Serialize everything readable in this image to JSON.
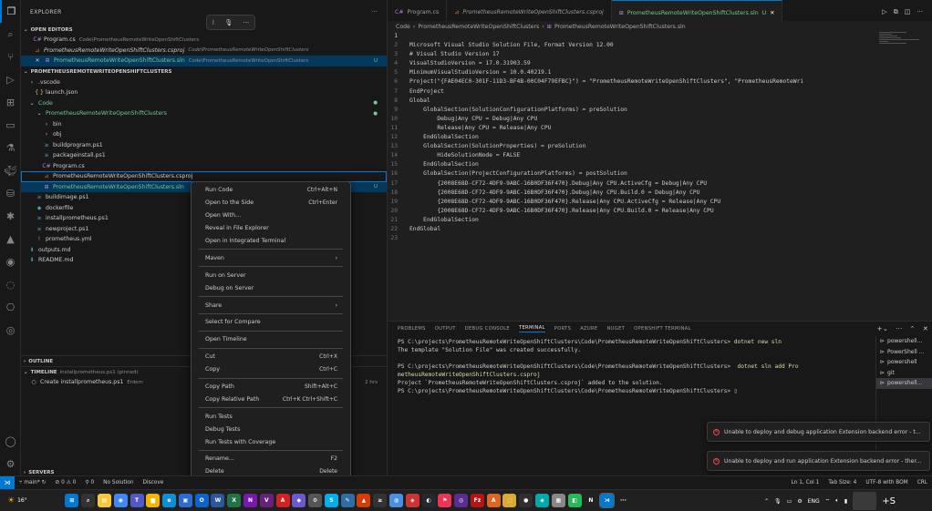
{
  "sidebar": {
    "title": "EXPLORER",
    "open_editors_label": "OPEN EDITORS",
    "open_editors": [
      {
        "name": "Program.cs",
        "path": "Code\\PrometheusRemoteWriteOpenShiftClusters",
        "icon": "csharp-icon"
      },
      {
        "name": "PrometheusRemoteWriteOpenShiftClusters.csproj",
        "path": "Code\\PrometheusRemoteWriteOpenShiftClusters",
        "icon": "rss-icon"
      },
      {
        "name": "PrometheusRemoteWriteOpenShiftClusters.sln",
        "path": "Code\\PrometheusRemoteWriteOpenShiftClusters",
        "badge": "U",
        "icon": "sln-icon"
      }
    ],
    "project_label": "PROMETHEUSREMOTEWRITEOPENSHIFTCLUSTERS",
    "tree": [
      {
        "label": ".vscode",
        "depth": 0,
        "twisty": "›",
        "type": "folder"
      },
      {
        "label": "launch.json",
        "depth": 1,
        "type": "json"
      },
      {
        "label": "Code",
        "depth": 0,
        "twisty": "⌄",
        "type": "folder",
        "dot": true
      },
      {
        "label": "PrometheusRemoteWriteOpenShiftClusters",
        "depth": 1,
        "twisty": "⌄",
        "type": "folder",
        "dot": true
      },
      {
        "label": "bin",
        "depth": 2,
        "twisty": "›",
        "type": "folder"
      },
      {
        "label": "obj",
        "depth": 2,
        "twisty": "›",
        "type": "folder"
      },
      {
        "label": "buildprogram.ps1",
        "depth": 2,
        "type": "ps1"
      },
      {
        "label": "packageinstall.ps1",
        "depth": 2,
        "type": "ps1"
      },
      {
        "label": "Program.cs",
        "depth": 2,
        "type": "cs"
      },
      {
        "label": "PrometheusRemoteWriteOpenShiftClusters.csproj",
        "depth": 2,
        "type": "csproj"
      },
      {
        "label": "PrometheusRemoteWriteOpenShiftClusters.sln",
        "depth": 2,
        "type": "sln",
        "badge": "U"
      },
      {
        "label": "buildimage.ps1",
        "depth": 1,
        "type": "ps1"
      },
      {
        "label": "dockerfile",
        "depth": 1,
        "type": "docker"
      },
      {
        "label": "installprometheus.ps1",
        "depth": 1,
        "type": "ps1"
      },
      {
        "label": "newproject.ps1",
        "depth": 1,
        "type": "ps1"
      },
      {
        "label": "prometheus.yml",
        "depth": 1,
        "type": "yml"
      },
      {
        "label": "outputs.md",
        "depth": 0,
        "type": "md"
      },
      {
        "label": "README.md",
        "depth": 0,
        "type": "md"
      }
    ],
    "outline_label": "OUTLINE",
    "timeline_label": "TIMELINE",
    "timeline_file": "installprometheus.ps1 (pinned)",
    "timeline_entry": "Create installprometheus.ps1",
    "timeline_author": "Erdem",
    "timeline_time": "2 hrs",
    "servers_label": "SERVERS"
  },
  "tabs": [
    {
      "label": "Program.cs",
      "icon": "csharp-icon"
    },
    {
      "label": "PrometheusRemoteWriteOpenShiftClusters.csproj",
      "icon": "rss-icon"
    },
    {
      "label": "PrometheusRemoteWriteOpenShiftClusters.sln",
      "badge": "U",
      "icon": "sln-icon"
    }
  ],
  "breadcrumb": [
    "Code",
    "PrometheusRemoteWriteOpenShiftClusters",
    "PrometheusRemoteWriteOpenShiftClusters.sln"
  ],
  "code_lines": [
    "",
    "Microsoft Visual Studio Solution File, Format Version 12.00",
    "# Visual Studio Version 17",
    "VisualStudioVersion = 17.0.31903.59",
    "MinimumVisualStudioVersion = 10.0.40219.1",
    "Project(\"{FAE04EC0-301F-11D3-BF4B-00C04F79EFBC}\") = \"PrometheusRemoteWriteOpenShiftClusters\", \"PrometheusRemoteWri",
    "EndProject",
    "Global",
    "    GlobalSection(SolutionConfigurationPlatforms) = preSolution",
    "        Debug|Any CPU = Debug|Any CPU",
    "        Release|Any CPU = Release|Any CPU",
    "    EndGlobalSection",
    "    GlobalSection(SolutionProperties) = preSolution",
    "        HideSolutionNode = FALSE",
    "    EndGlobalSection",
    "    GlobalSection(ProjectConfigurationPlatforms) = postSolution",
    "        {2008E68D-CF72-4DF9-9ABC-16B0DF36F470}.Debug|Any CPU.ActiveCfg = Debug|Any CPU",
    "        {2008E68D-CF72-4DF9-9ABC-16B0DF36F470}.Debug|Any CPU.Build.0 = Debug|Any CPU",
    "        {2008E68D-CF72-4DF9-9ABC-16B0DF36F470}.Release|Any CPU.ActiveCfg = Release|Any CPU",
    "        {2008E68D-CF72-4DF9-9ABC-16B0DF36F470}.Release|Any CPU.Build.0 = Release|Any CPU",
    "    EndGlobalSection",
    "EndGlobal",
    ""
  ],
  "panel": {
    "tabs": [
      "PROBLEMS",
      "OUTPUT",
      "DEBUG CONSOLE",
      "TERMINAL",
      "PORTS",
      "AZURE",
      "NUGET",
      "OPENSHIFT TERMINAL"
    ],
    "active_tab": "TERMINAL",
    "terminal": {
      "prompt1": "PS C:\\projects\\PrometheusRemoteWriteOpenShiftClusters\\Code\\PrometheusRemoteWriteOpenShiftClusters> ",
      "cmd1": "dotnet new sln",
      "out1": "The template \"Solution File\" was created successfully.",
      "prompt2": "PS C:\\projects\\PrometheusRemoteWriteOpenShiftClusters\\Code\\PrometheusRemoteWriteOpenShiftClusters>  ",
      "cmd2": "dotnet sln add Pro",
      "cont2": "metheusRemoteWriteOpenShiftClusters.csproj",
      "out2": "Project `PrometheusRemoteWriteOpenShiftClusters.csproj` added to the solution.",
      "prompt3": "PS C:\\projects\\PrometheusRemoteWriteOpenShiftClusters\\Code\\PrometheusRemoteWriteOpenShiftClusters> "
    },
    "terminals": [
      "powershell...",
      "PowerShell ...",
      "powershell",
      "git",
      "powershell..."
    ]
  },
  "notifications": [
    "Unable to deploy and debug application Extension backend error - t...",
    "Unable to deploy and run application Extension backend error - ther..."
  ],
  "context_menu": [
    {
      "label": "Run Code",
      "shortcut": "Ctrl+Alt+N"
    },
    {
      "label": "Open to the Side",
      "shortcut": "Ctrl+Enter"
    },
    {
      "label": "Open With...",
      "shortcut": ""
    },
    {
      "label": "Reveal in File Explorer",
      "shortcut": ""
    },
    {
      "label": "Open in Integrated Terminal",
      "shortcut": ""
    },
    {
      "sep": true
    },
    {
      "label": "Maven",
      "shortcut": "›"
    },
    {
      "sep": true
    },
    {
      "label": "Run on Server",
      "shortcut": ""
    },
    {
      "label": "Debug on Server",
      "shortcut": ""
    },
    {
      "sep": true
    },
    {
      "label": "Share",
      "shortcut": "›"
    },
    {
      "sep": true
    },
    {
      "label": "Select for Compare",
      "shortcut": ""
    },
    {
      "sep": true
    },
    {
      "label": "Open Timeline",
      "shortcut": ""
    },
    {
      "sep": true
    },
    {
      "label": "Cut",
      "shortcut": "Ctrl+X"
    },
    {
      "label": "Copy",
      "shortcut": "Ctrl+C"
    },
    {
      "sep": true
    },
    {
      "label": "Copy Path",
      "shortcut": "Shift+Alt+C"
    },
    {
      "label": "Copy Relative Path",
      "shortcut": "Ctrl+K Ctrl+Shift+C"
    },
    {
      "sep": true
    },
    {
      "label": "Run Tests",
      "shortcut": ""
    },
    {
      "label": "Debug Tests",
      "shortcut": ""
    },
    {
      "label": "Run Tests with Coverage",
      "shortcut": ""
    },
    {
      "sep": true
    },
    {
      "label": "Rename...",
      "shortcut": "F2"
    },
    {
      "label": "Delete",
      "shortcut": "Delete"
    }
  ],
  "status": {
    "branch": "main*",
    "sync": "↻",
    "errors": "⊘ 0 ⚠ 0",
    "ports": "⚲ 0",
    "solution": "No Solution",
    "discover": "Discove",
    "position": "Ln 1, Col 1",
    "spaces": "Tab Size: 4",
    "encoding": "UTF-8 with BOM",
    "eol": "CRL"
  },
  "taskbar": {
    "weather": "16°",
    "lang": "ENG",
    "icons": [
      "start",
      "search",
      "files",
      "chrome",
      "teams",
      "folder",
      "edge",
      "store",
      "outlook",
      "word",
      "excel",
      "onenote",
      "vs",
      "acrobat",
      "app",
      "settings",
      "skype",
      "notepad",
      "photos",
      "terminal",
      "app2",
      "app3",
      "github",
      "app4",
      "app5",
      "filezilla",
      "acrobat2",
      "app6",
      "obs",
      "app7",
      "app8",
      "app9",
      "notion",
      "vscode",
      "more"
    ]
  },
  "colors": {
    "accent": "#0078d4",
    "git_added": "#73c991",
    "error": "#f14c4c"
  }
}
